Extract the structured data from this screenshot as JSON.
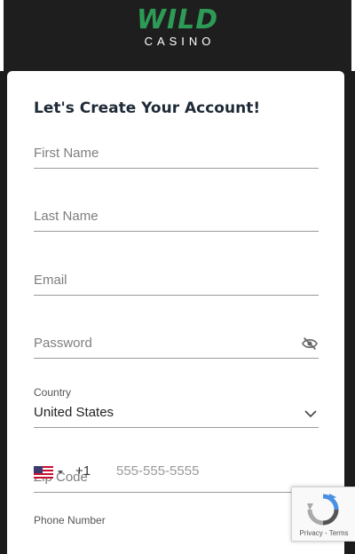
{
  "brand": {
    "logo_main": "WILD",
    "logo_sub": "CASINO",
    "accent": "#2d9a55"
  },
  "form": {
    "title": "Let's Create Your Account!",
    "first_name_placeholder": "First Name",
    "last_name_placeholder": "Last Name",
    "email_placeholder": "Email",
    "password_placeholder": "Password",
    "country_label": "Country",
    "country_value": "United States",
    "zip_placeholder": "Zip Code",
    "phone_label": "Phone Number",
    "phone_country_code": "+1",
    "phone_placeholder": "555-555-5555"
  },
  "recaptcha": {
    "privacy": "Privacy",
    "separator": " - ",
    "terms": "Terms"
  }
}
